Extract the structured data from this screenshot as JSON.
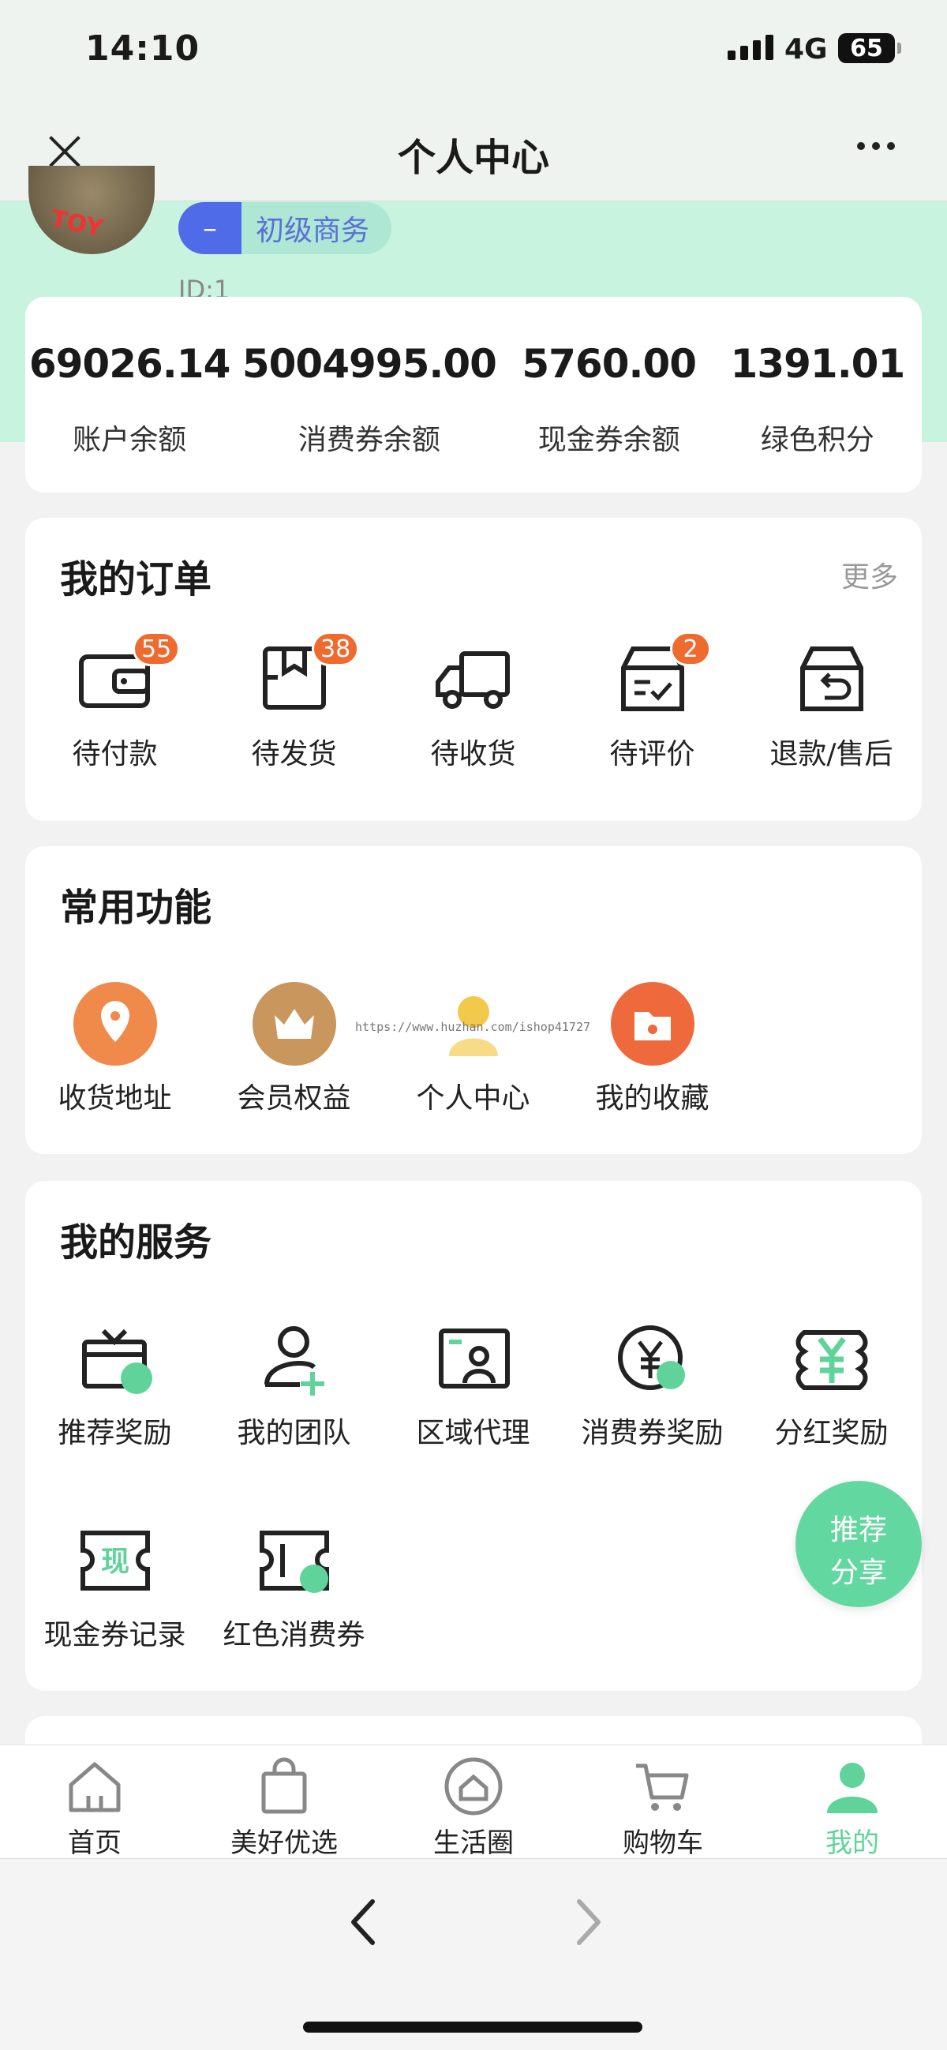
{
  "status": {
    "time": "14:10",
    "network": "4G",
    "battery": "65"
  },
  "nav": {
    "title": "个人中心"
  },
  "profile": {
    "level_symbol": "–",
    "level": "初级商务",
    "id": "ID:1",
    "avatar_text": "TOY"
  },
  "stats": [
    {
      "value": "69026.14",
      "label": "账户余额"
    },
    {
      "value": "5004995.00",
      "label": "消费券余额"
    },
    {
      "value": "5760.00",
      "label": "现金券余额"
    },
    {
      "value": "1391.01",
      "label": "绿色积分"
    }
  ],
  "orders": {
    "title": "我的订单",
    "more": "更多",
    "items": [
      {
        "label": "待付款",
        "badge": "55",
        "icon": "wallet-icon"
      },
      {
        "label": "待发货",
        "badge": "38",
        "icon": "box-icon"
      },
      {
        "label": "待收货",
        "badge": "",
        "icon": "truck-icon"
      },
      {
        "label": "待评价",
        "badge": "2",
        "icon": "review-box-icon"
      },
      {
        "label": "退款/售后",
        "badge": "",
        "icon": "return-icon"
      }
    ]
  },
  "common": {
    "title": "常用功能",
    "items": [
      {
        "label": "收货地址",
        "icon": "location-pin-icon",
        "color": "#f08a4b"
      },
      {
        "label": "会员权益",
        "icon": "crown-icon",
        "color": "#c9965d"
      },
      {
        "label": "个人中心",
        "icon": "person-icon",
        "color": "#f3c94a"
      },
      {
        "label": "我的收藏",
        "icon": "folder-star-icon",
        "color": "#ee6a3c"
      }
    ]
  },
  "watermark": "https://www.huzhan.com/ishop41727",
  "services": {
    "title": "我的服务",
    "items": [
      {
        "label": "推荐奖励",
        "icon": "gift-icon"
      },
      {
        "label": "我的团队",
        "icon": "add-user-icon"
      },
      {
        "label": "区域代理",
        "icon": "contact-card-icon"
      },
      {
        "label": "消费券奖励",
        "icon": "yen-coin-icon"
      },
      {
        "label": "分红奖励",
        "icon": "yen-stack-icon"
      },
      {
        "label": "现金券记录",
        "icon": "cash-voucher-icon",
        "voucher_text": "现"
      },
      {
        "label": "红色消费券",
        "icon": "voucher-icon"
      }
    ]
  },
  "fab": {
    "line1": "推荐",
    "line2": "分享"
  },
  "accent": "#5fd39a",
  "tabs": [
    {
      "label": "首页",
      "icon": "home-icon"
    },
    {
      "label": "美好优选",
      "icon": "shopping-bag-icon"
    },
    {
      "label": "生活圈",
      "icon": "circle-home-icon"
    },
    {
      "label": "购物车",
      "icon": "cart-icon"
    },
    {
      "label": "我的",
      "icon": "user-icon",
      "active": true
    }
  ]
}
